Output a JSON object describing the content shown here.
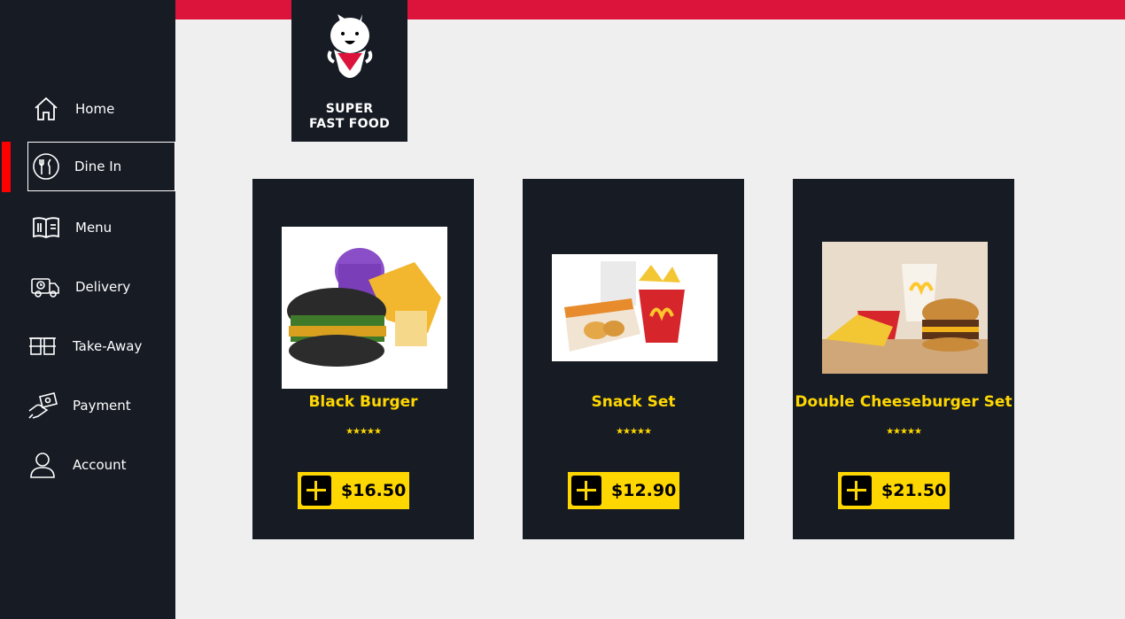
{
  "app": {
    "logo_line1": "SUPER",
    "logo_line2": "FAST FOOD",
    "accent_color": "#dc143c",
    "highlight_color": "#ffd700",
    "sidebar_color": "#161b24"
  },
  "sidebar": {
    "items": [
      {
        "label": "Home",
        "icon": "home-icon"
      },
      {
        "label": "Dine In",
        "icon": "dine-in-icon",
        "active": true
      },
      {
        "label": "Menu",
        "icon": "menu-book-icon"
      },
      {
        "label": "Delivery",
        "icon": "delivery-truck-icon"
      },
      {
        "label": "Take-Away",
        "icon": "take-away-cups-icon"
      },
      {
        "label": "Payment",
        "icon": "payment-icon"
      },
      {
        "label": "Account",
        "icon": "account-icon"
      }
    ]
  },
  "products": [
    {
      "name": "Black Burger",
      "price": "$16.50",
      "rating": "★★★★★"
    },
    {
      "name": "Snack Set",
      "price": "$12.90",
      "rating": "★★★★★"
    },
    {
      "name": "Double Cheeseburger Set",
      "price": "$21.50",
      "rating": "★★★★★"
    }
  ]
}
